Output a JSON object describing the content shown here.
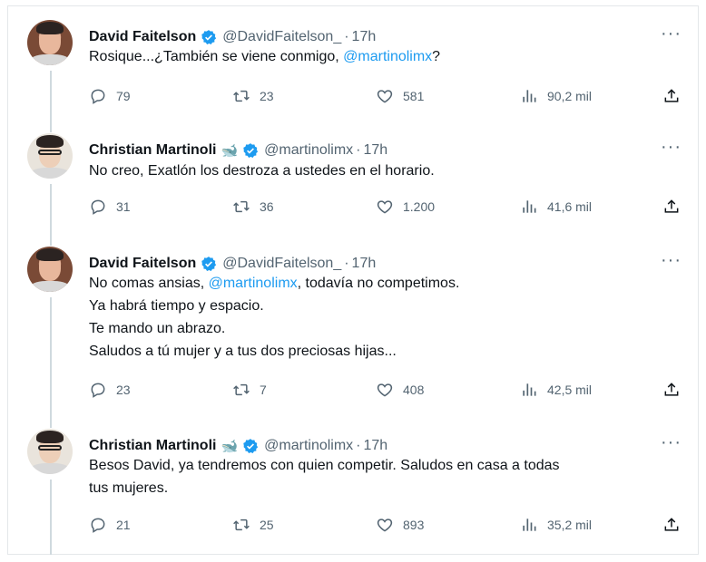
{
  "tweets": [
    {
      "name": "David Faitelson",
      "whale": false,
      "handle": "@DavidFaitelson_",
      "time": "17h",
      "lines": [
        [
          {
            "t": "Rosique...¿También se viene conmigo, "
          },
          {
            "t": "@martinolimx",
            "m": true
          },
          {
            "t": "?"
          }
        ]
      ],
      "replies": "79",
      "retweets": "23",
      "likes": "581",
      "views": "90,2 mil"
    },
    {
      "name": "Christian Martinoli",
      "whale": true,
      "handle": "@martinolimx",
      "time": "17h",
      "lines": [
        [
          {
            "t": "No creo, Exatlón los destroza a ustedes  en el horario."
          }
        ]
      ],
      "replies": "31",
      "retweets": "36",
      "likes": "1.200",
      "views": "41,6 mil"
    },
    {
      "name": "David Faitelson",
      "whale": false,
      "handle": "@DavidFaitelson_",
      "time": "17h",
      "lines": [
        [
          {
            "t": "No comas ansias, "
          },
          {
            "t": "@martinolimx",
            "m": true
          },
          {
            "t": ", todavía no competimos."
          }
        ],
        [
          {
            "t": "Ya habrá tiempo y espacio."
          }
        ],
        [
          {
            "t": "Te mando un abrazo."
          }
        ],
        [
          {
            "t": "Saludos a tú mujer y a tus dos preciosas hijas..."
          }
        ]
      ],
      "replies": "23",
      "retweets": "7",
      "likes": "408",
      "views": "42,5 mil"
    },
    {
      "name": "Christian Martinoli",
      "whale": true,
      "handle": "@martinolimx",
      "time": "17h",
      "lines": [
        [
          {
            "t": "Besos David, ya tendremos con quien competir. Saludos en casa a todas"
          }
        ],
        [
          {
            "t": "tus mujeres."
          }
        ]
      ],
      "replies": "21",
      "retweets": "25",
      "likes": "893",
      "views": "35,2 mil"
    }
  ],
  "ui": {
    "separator": "·",
    "more": "···",
    "whale_emoji": "🐋"
  },
  "colors": {
    "accent": "#1d9bf0",
    "muted": "#536471",
    "text": "#0f1419"
  }
}
